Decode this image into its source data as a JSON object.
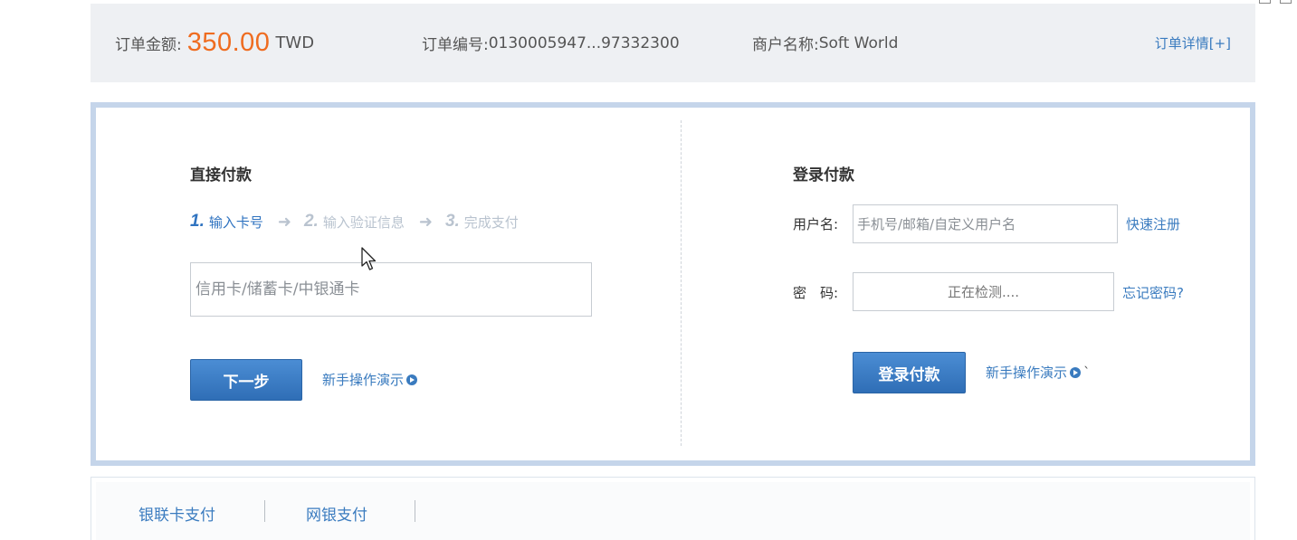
{
  "summary": {
    "amount_label": "订单金额:",
    "amount_value": "350.00",
    "currency": "TWD",
    "order_no_label": "订单编号:",
    "order_no_value": "0130005947...97332300",
    "merchant_label": "商户名称:",
    "merchant_value": "Soft World",
    "detail_link": "订单详情[+]"
  },
  "direct_pay": {
    "title": "直接付款",
    "steps": [
      {
        "num": "1.",
        "text": "输入卡号"
      },
      {
        "num": "2.",
        "text": "输入验证信息"
      },
      {
        "num": "3.",
        "text": "完成支付"
      }
    ],
    "card_placeholder": "信用卡/储蓄卡/中银通卡",
    "next_button": "下一步",
    "demo_link": "新手操作演示"
  },
  "login_pay": {
    "title": "登录付款",
    "username_label": "用户名:",
    "username_placeholder": "手机号/邮箱/自定义用户名",
    "register_link": "快速注册",
    "password_label": "密　码:",
    "password_placeholder": "正在检测....",
    "forgot_link": "忘记密码?",
    "login_button": "登录付款",
    "demo_link": "新手操作演示",
    "demo_suffix": "`"
  },
  "tabs": [
    {
      "label": "银联卡支付"
    },
    {
      "label": "网银支付"
    }
  ],
  "colors": {
    "amount": "#ef6c20",
    "link": "#3a7bbf",
    "button": "#2f6eb6",
    "panel_border": "#c5d5ea",
    "summary_bg": "#eef0f3"
  },
  "icons": {
    "play": "play-circle-icon",
    "arrow": "right-arrow-icon",
    "cursor": "mouse-cursor-icon"
  }
}
